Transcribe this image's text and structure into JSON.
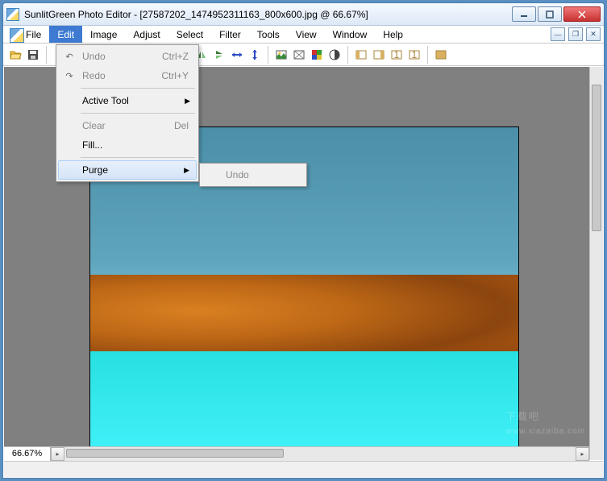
{
  "title_bar": {
    "app": "SunlitGreen Photo Editor",
    "doc": "[27587202_1474952311163_800x600.jpg @ 66.67%]"
  },
  "menus": {
    "file": "File",
    "edit": "Edit",
    "image": "Image",
    "adjust": "Adjust",
    "select": "Select",
    "filter": "Filter",
    "tools": "Tools",
    "view": "View",
    "window": "Window",
    "help": "Help"
  },
  "edit_menu": {
    "undo": {
      "label": "Undo",
      "shortcut": "Ctrl+Z"
    },
    "redo": {
      "label": "Redo",
      "shortcut": "Ctrl+Y"
    },
    "active_tool": {
      "label": "Active Tool"
    },
    "clear": {
      "label": "Clear",
      "shortcut": "Del"
    },
    "fill": {
      "label": "Fill..."
    },
    "purge": {
      "label": "Purge"
    }
  },
  "purge_submenu": {
    "undo": "Undo"
  },
  "zoom": "66.67%",
  "icons": {
    "open": "open",
    "save": "save",
    "undo": "undo",
    "redo": "redo",
    "flip_h": "flip-h",
    "flip_v": "flip-v",
    "resize_h": "resize-h",
    "resize_v": "resize-v",
    "img1": "photo",
    "img2": "filter",
    "img3": "palette",
    "img4": "half",
    "g1": "panel-l",
    "g2": "panel-r",
    "g3": "panel-1",
    "g4": "panel-2",
    "g5": "panel-full"
  },
  "watermark": {
    "text": "下载吧",
    "sub": "www.xiazaiba.com"
  }
}
